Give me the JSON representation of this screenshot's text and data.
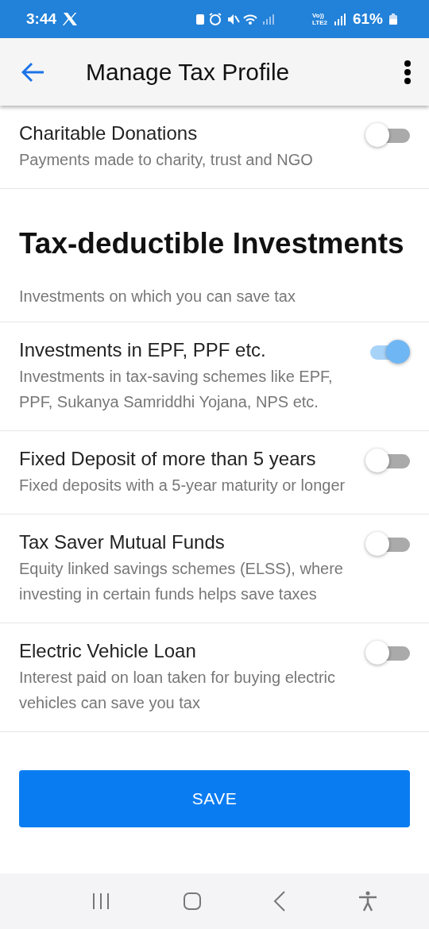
{
  "status_bar": {
    "time": "3:44",
    "network_top": "Vo))",
    "network_bottom": "LTE2",
    "battery": "61%"
  },
  "app_bar": {
    "title": "Manage Tax Profile"
  },
  "top_items": [
    {
      "title": "Charitable Donations",
      "description": "Payments made to charity, trust and NGO",
      "on": false
    }
  ],
  "section": {
    "title": "Tax-deductible Investments",
    "subtitle": "Investments on which you can save tax"
  },
  "items": [
    {
      "title": "Investments in EPF, PPF etc.",
      "description": "Investments in tax-saving schemes like EPF, PPF, Sukanya Samriddhi Yojana, NPS etc.",
      "on": true
    },
    {
      "title": "Fixed Deposit of more than 5 years",
      "description": "Fixed deposits with a 5-year maturity or longer",
      "on": false
    },
    {
      "title": "Tax Saver Mutual Funds",
      "description": "Equity linked savings schemes (ELSS), where investing in certain funds helps save taxes",
      "on": false
    },
    {
      "title": "Electric Vehicle Loan",
      "description": "Interest paid on loan taken for buying electric vehicles can save you tax",
      "on": false
    }
  ],
  "save_button": {
    "label": "SAVE"
  }
}
